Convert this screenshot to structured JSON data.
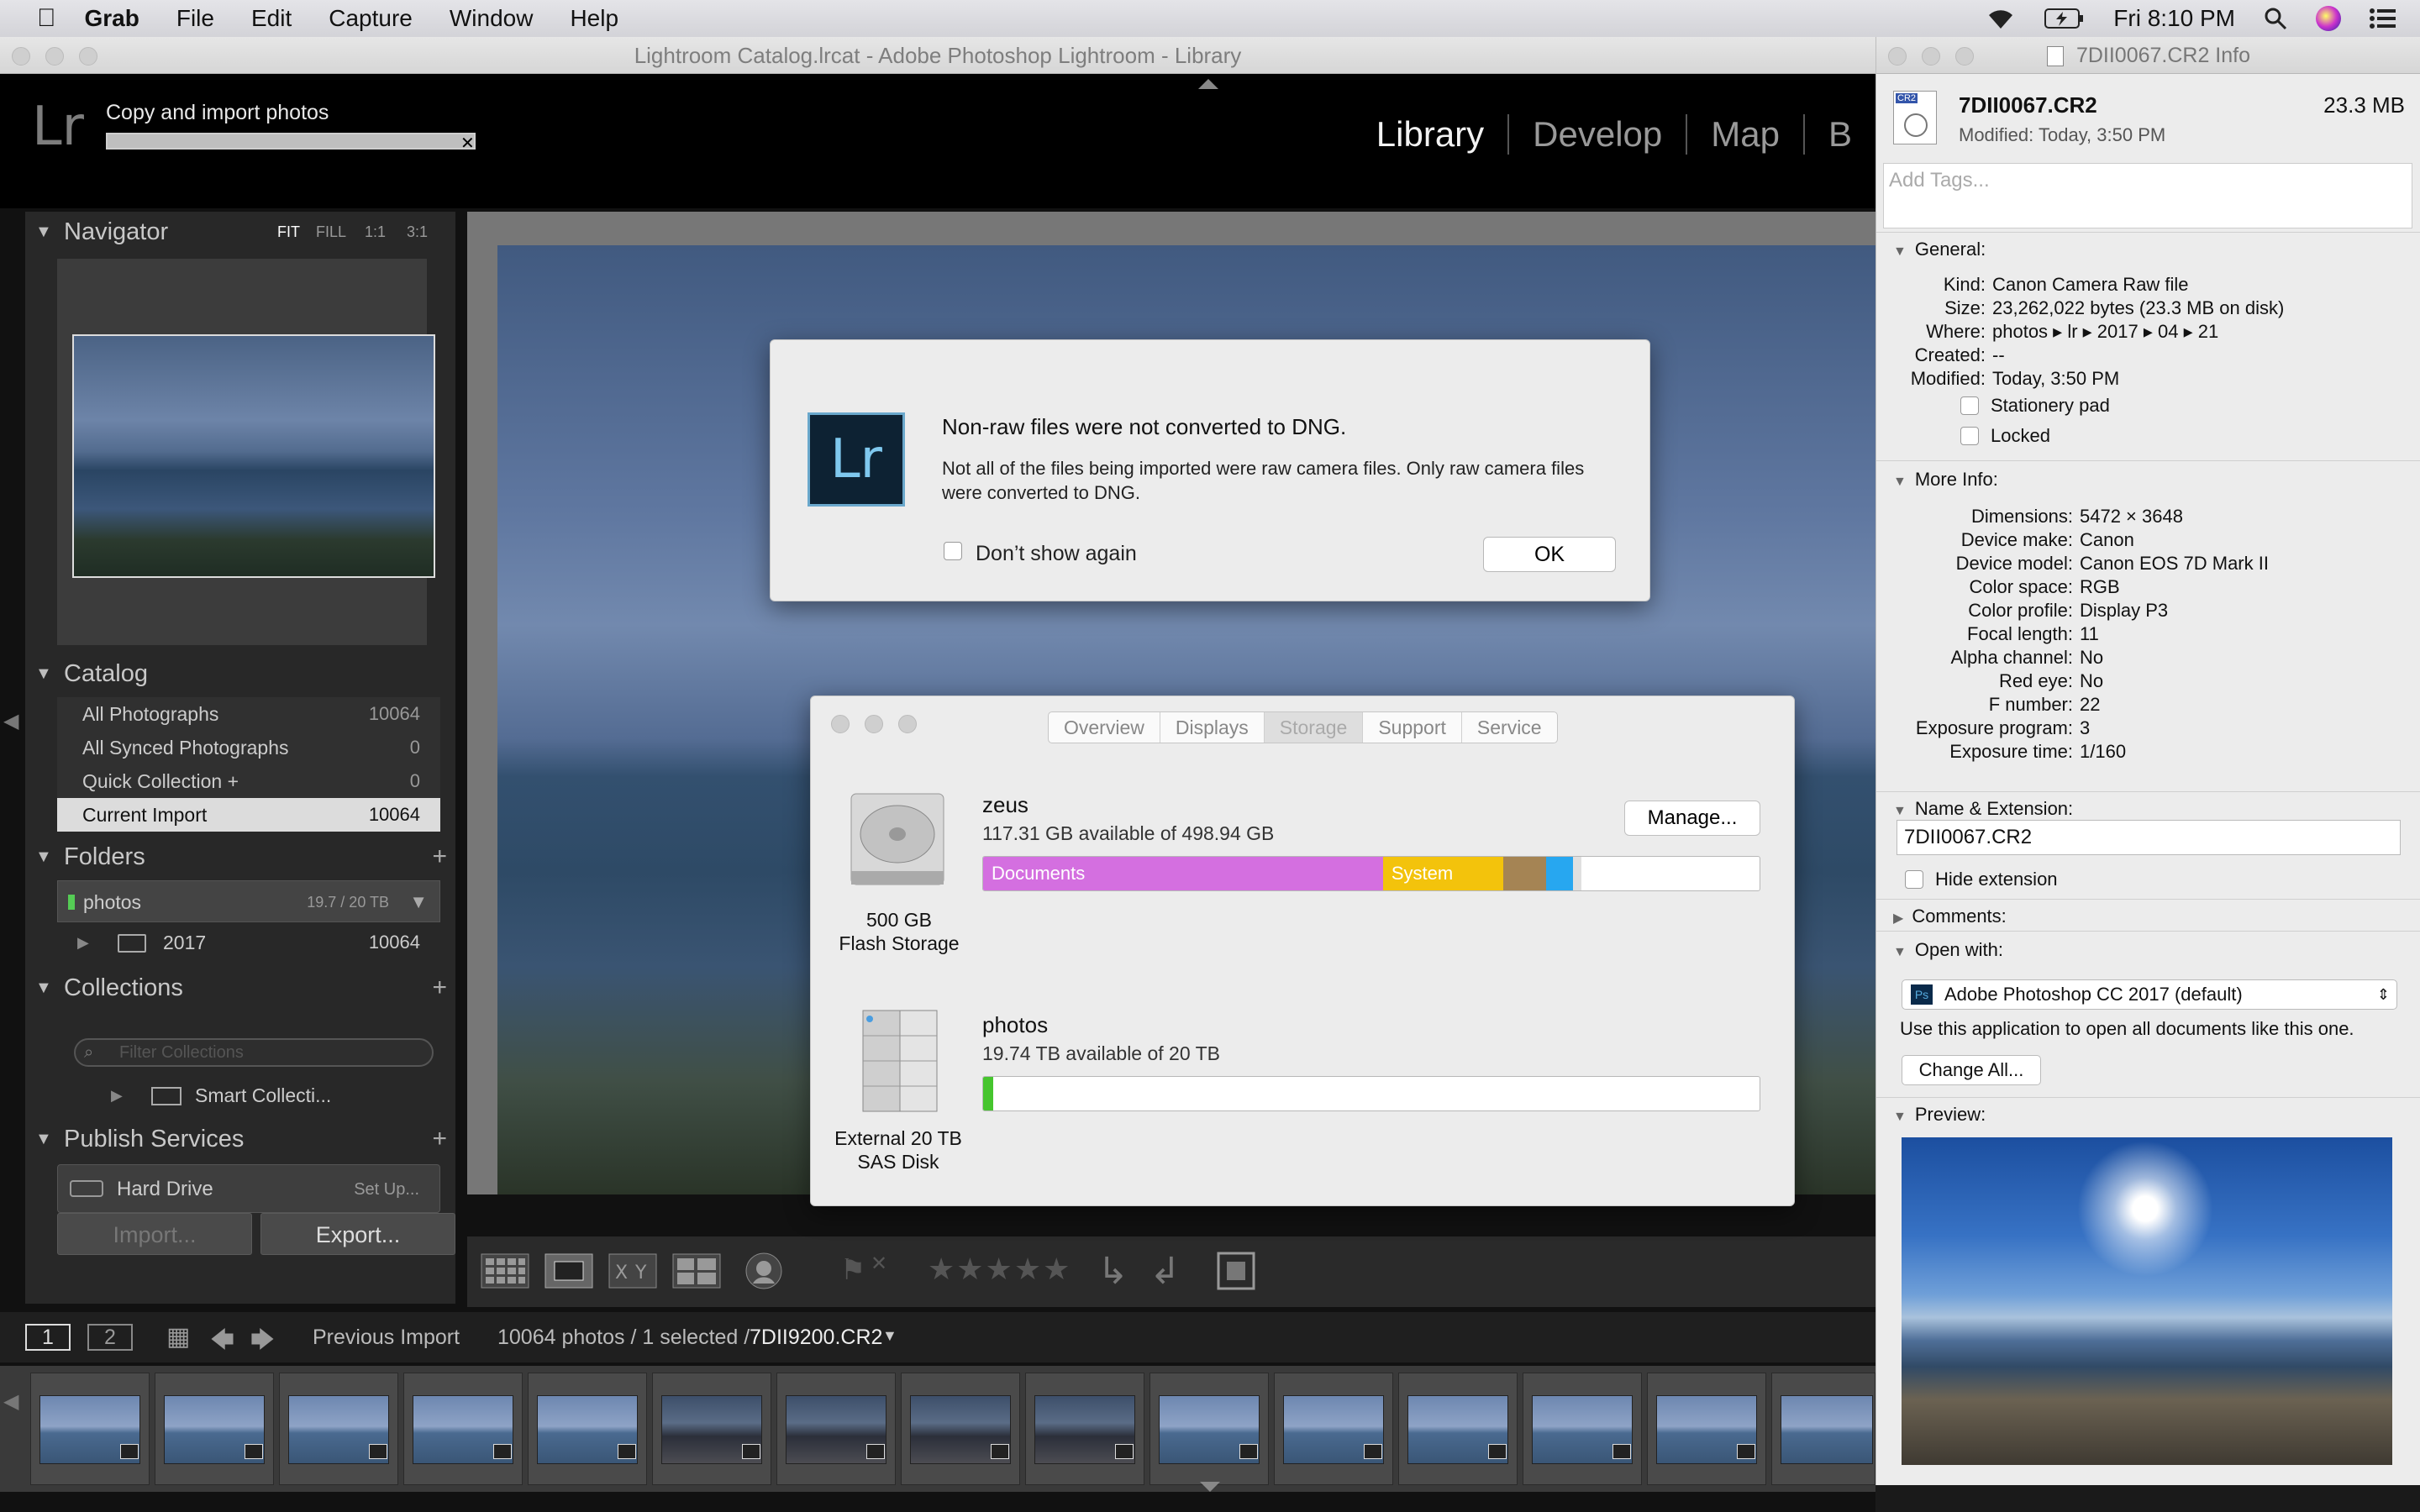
{
  "menubar": {
    "apple": "",
    "app": "Grab",
    "items": [
      "File",
      "Edit",
      "Capture",
      "Window",
      "Help"
    ],
    "clock": "Fri 8:10 PM"
  },
  "lr": {
    "window_title": "Lightroom Catalog.lrcat - Adobe Photoshop Lightroom - Library",
    "logo": "Lr",
    "import_label": "Copy and import photos",
    "modules": [
      "Library",
      "Develop",
      "Map",
      "B"
    ],
    "navigator": {
      "title": "Navigator",
      "zoom": [
        "FIT",
        "FILL",
        "1:1",
        "3:1"
      ]
    },
    "catalog": {
      "title": "Catalog",
      "items": [
        {
          "label": "All Photographs",
          "count": "10064"
        },
        {
          "label": "All Synced Photographs",
          "count": "0"
        },
        {
          "label": "Quick Collection  +",
          "count": "0"
        },
        {
          "label": "Current Import",
          "count": "10064"
        }
      ]
    },
    "folders": {
      "title": "Folders",
      "volume": "photos",
      "volume_size": "19.7 / 20 TB",
      "folder": "2017",
      "folder_count": "10064"
    },
    "collections": {
      "title": "Collections",
      "filter_placeholder": "Filter Collections",
      "item": "Smart Collecti..."
    },
    "publish": {
      "title": "Publish Services",
      "service": "Hard Drive",
      "setup": "Set Up..."
    },
    "import_btn": "Import...",
    "export_btn": "Export...",
    "filmstrip": {
      "view1": "1",
      "view2": "2",
      "source": "Previous Import",
      "summary": "10064 photos / 1 selected /",
      "selected_file": "7DII9200.CR2"
    }
  },
  "info": {
    "title": "7DII0067.CR2 Info",
    "file_name": "7DII0067.CR2",
    "file_size": "23.3 MB",
    "modified_header": "Modified:  Today, 3:50 PM",
    "tags_placeholder": "Add Tags...",
    "general": {
      "title": "General:",
      "rows": [
        {
          "k": "Kind:",
          "v": "Canon Camera Raw file"
        },
        {
          "k": "Size:",
          "v": "23,262,022 bytes (23.3 MB on disk)"
        },
        {
          "k": "Where:",
          "v": "photos ▸ lr ▸ 2017 ▸ 04 ▸ 21"
        },
        {
          "k": "Created:",
          "v": "--"
        },
        {
          "k": "Modified:",
          "v": "Today, 3:50 PM"
        }
      ],
      "stationery": "Stationery pad",
      "locked": "Locked"
    },
    "more": {
      "title": "More Info:",
      "rows": [
        {
          "k": "Dimensions:",
          "v": "5472 × 3648"
        },
        {
          "k": "Device make:",
          "v": "Canon"
        },
        {
          "k": "Device model:",
          "v": "Canon EOS 7D Mark II"
        },
        {
          "k": "Color space:",
          "v": "RGB"
        },
        {
          "k": "Color profile:",
          "v": "Display P3"
        },
        {
          "k": "Focal length:",
          "v": "11"
        },
        {
          "k": "Alpha channel:",
          "v": "No"
        },
        {
          "k": "Red eye:",
          "v": "No"
        },
        {
          "k": "F number:",
          "v": "22"
        },
        {
          "k": "Exposure program:",
          "v": "3"
        },
        {
          "k": "Exposure time:",
          "v": "1/160"
        }
      ]
    },
    "name_ext": {
      "title": "Name & Extension:",
      "value": "7DII0067.CR2",
      "hide": "Hide extension"
    },
    "comments": "Comments:",
    "open_with": {
      "title": "Open with:",
      "app": "Adobe Photoshop CC 2017 (default)",
      "note": "Use this application to open all documents like this one.",
      "change_all": "Change All..."
    },
    "preview": "Preview:"
  },
  "dng_dialog": {
    "icon": "Lr",
    "title": "Non-raw files were not converted to DNG.",
    "message": "Not all of the files being imported were raw camera files. Only raw camera files were converted to DNG.",
    "dont_show": "Don’t show again",
    "ok": "OK"
  },
  "storage": {
    "tabs": [
      "Overview",
      "Displays",
      "Storage",
      "Support",
      "Service"
    ],
    "active_tab": "Storage",
    "manage": "Manage...",
    "disk1": {
      "name": "zeus",
      "available": "117.31 GB available of 498.94 GB",
      "label1": "500 GB",
      "label2": "Flash Storage",
      "segments": [
        {
          "label": "Documents",
          "color": "#d46fe0",
          "fraction": 0.515
        },
        {
          "label": "System",
          "color": "#f3c30c",
          "fraction": 0.155
        },
        {
          "label": "",
          "color": "#a58454",
          "fraction": 0.055
        },
        {
          "label": "",
          "color": "#27a7f0",
          "fraction": 0.035
        },
        {
          "label": "",
          "color": "#e0e0e0",
          "fraction": 0.01
        }
      ]
    },
    "disk2": {
      "name": "photos",
      "available": "19.74 TB available of 20 TB",
      "label1": "External 20 TB",
      "label2": "SAS Disk",
      "used_fraction": 0.013,
      "used_color": "#46c52e"
    }
  }
}
